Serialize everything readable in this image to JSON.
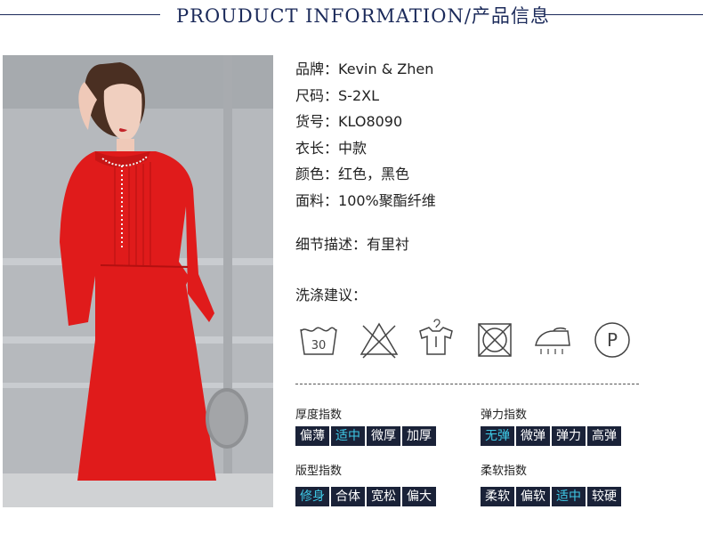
{
  "header": {
    "title": "PROUDUCT INFORMATION/产品信息"
  },
  "info": [
    {
      "key": "品牌：",
      "value": "Kevin & Zhen"
    },
    {
      "key": "尺码：",
      "value": "S-2XL"
    },
    {
      "key": "货号：",
      "value": "KLO8090"
    },
    {
      "key": "衣长：",
      "value": "中款"
    },
    {
      "key": "颜色：",
      "value": "红色，黑色"
    },
    {
      "key": "面料：",
      "value": "100%聚酯纤维"
    }
  ],
  "detail": {
    "key": "细节描述：",
    "value": "有里衬"
  },
  "wash": {
    "label": "洗涤建议：",
    "icons": [
      "wash-30-icon",
      "no-bleach-icon",
      "hang-dry-icon",
      "no-tumble-dry-icon",
      "iron-steam-icon",
      "dry-clean-p-icon"
    ],
    "wash_temp": "30",
    "dryclean_letter": "P"
  },
  "indices": {
    "thickness": {
      "title": "厚度指数",
      "options": [
        "偏薄",
        "适中",
        "微厚",
        "加厚"
      ],
      "selected": "适中"
    },
    "elasticity": {
      "title": "弹力指数",
      "options": [
        "无弹",
        "微弹",
        "弹力",
        "高弹"
      ],
      "selected": "无弹"
    },
    "fit": {
      "title": "版型指数",
      "options": [
        "修身",
        "合体",
        "宽松",
        "偏大"
      ],
      "selected": "修身"
    },
    "softness": {
      "title": "柔软指数",
      "options": [
        "柔软",
        "偏软",
        "适中",
        "较硬"
      ],
      "selected": "适中"
    }
  },
  "colors": {
    "accent": "#3ec9e6",
    "navy": "#1a2238",
    "dress_red": "#e01b1b"
  }
}
